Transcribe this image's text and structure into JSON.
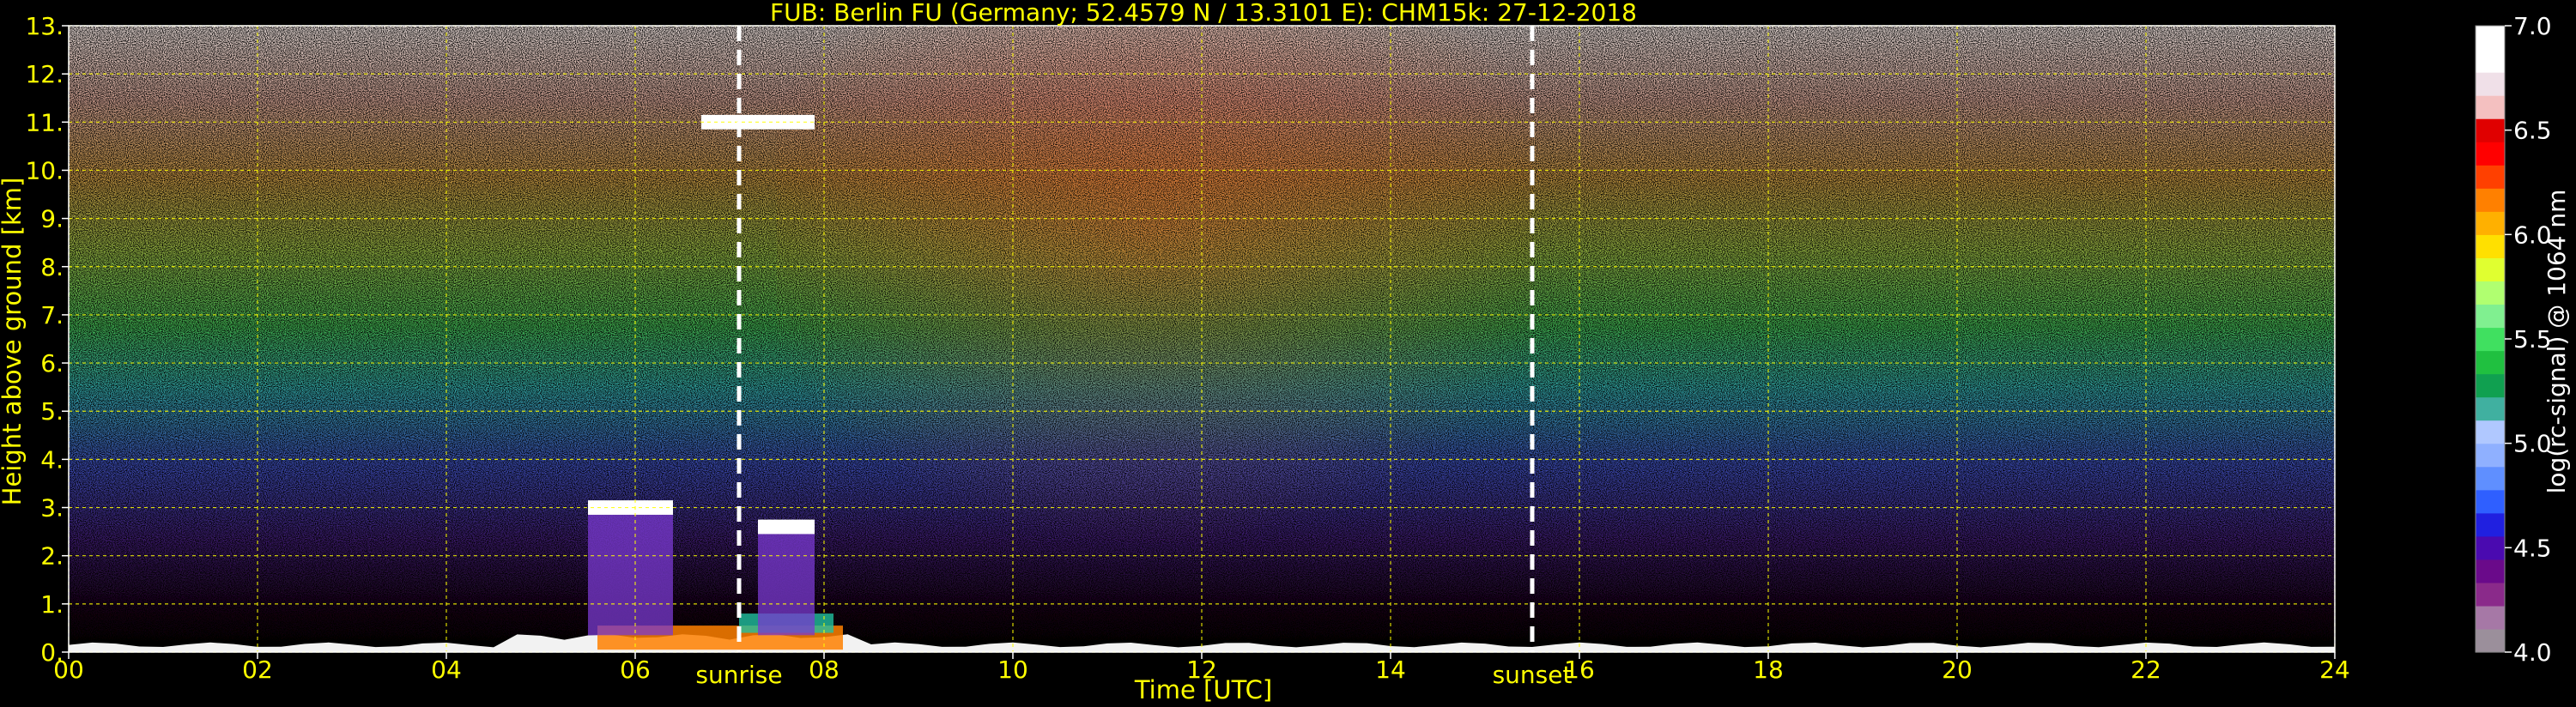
{
  "chart_data": {
    "type": "heatmap",
    "title": "FUB: Berlin FU (Germany; 52.4579 N / 13.3101 E):    CHM15k: 27-12-2018",
    "xlabel": "Time [UTC]",
    "ylabel": "Height above ground [km]",
    "colorbar_label": "log(rc-signal) @ 1064 nm",
    "xlim": [
      0,
      24
    ],
    "ylim": [
      0,
      13
    ],
    "x_ticks": [
      0,
      2,
      4,
      6,
      8,
      10,
      12,
      14,
      16,
      18,
      20,
      22,
      24
    ],
    "x_tick_labels": [
      "00",
      "02",
      "04",
      "06",
      "08",
      "10",
      "12",
      "14",
      "16",
      "18",
      "20",
      "22",
      "24"
    ],
    "y_ticks": [
      0,
      1,
      2,
      3,
      4,
      5,
      6,
      7,
      8,
      9,
      10,
      11,
      12,
      13
    ],
    "y_tick_labels": [
      "0.",
      "1.",
      "2.",
      "3.",
      "4.",
      "5.",
      "6.",
      "7.",
      "8.",
      "9.",
      "10.",
      "11.",
      "12.",
      "13."
    ],
    "colorbar_range": [
      4.0,
      7.0
    ],
    "colorbar_ticks": [
      4.0,
      4.5,
      5.0,
      5.5,
      6.0,
      6.5,
      7.0
    ],
    "colorbar_tick_labels": [
      "4.0",
      "4.5",
      "5.0",
      "5.5",
      "6.0",
      "6.5",
      "7.0"
    ],
    "colorbar_colors": [
      "#9b8f9b",
      "#a678a6",
      "#8a2a8a",
      "#6a0a8a",
      "#4a0ab0",
      "#2020e0",
      "#2f5fff",
      "#5f8fff",
      "#8fb0ff",
      "#b0c8ff",
      "#40b0a0",
      "#10a050",
      "#20c040",
      "#40e060",
      "#80f090",
      "#b0ff70",
      "#e0ff30",
      "#ffe000",
      "#ffb000",
      "#ff8000",
      "#ff4000",
      "#ff0000",
      "#e00000",
      "#f4c0c0",
      "#f0e0e8",
      "#ffffff",
      "#ffffff"
    ],
    "grid": true,
    "grid_color": "#ffff00",
    "text_color": "#ffff00",
    "annotations": [
      {
        "label": "sunrise",
        "x": 7.1
      },
      {
        "label": "sunset",
        "x": 15.5
      }
    ],
    "cloud_features": [
      {
        "x_start": 5.5,
        "x_end": 6.4,
        "height": 3.0
      },
      {
        "x_start": 7.3,
        "x_end": 7.9,
        "height": 2.6
      },
      {
        "x_start": 6.7,
        "x_end": 7.9,
        "height": 11.0
      }
    ]
  }
}
